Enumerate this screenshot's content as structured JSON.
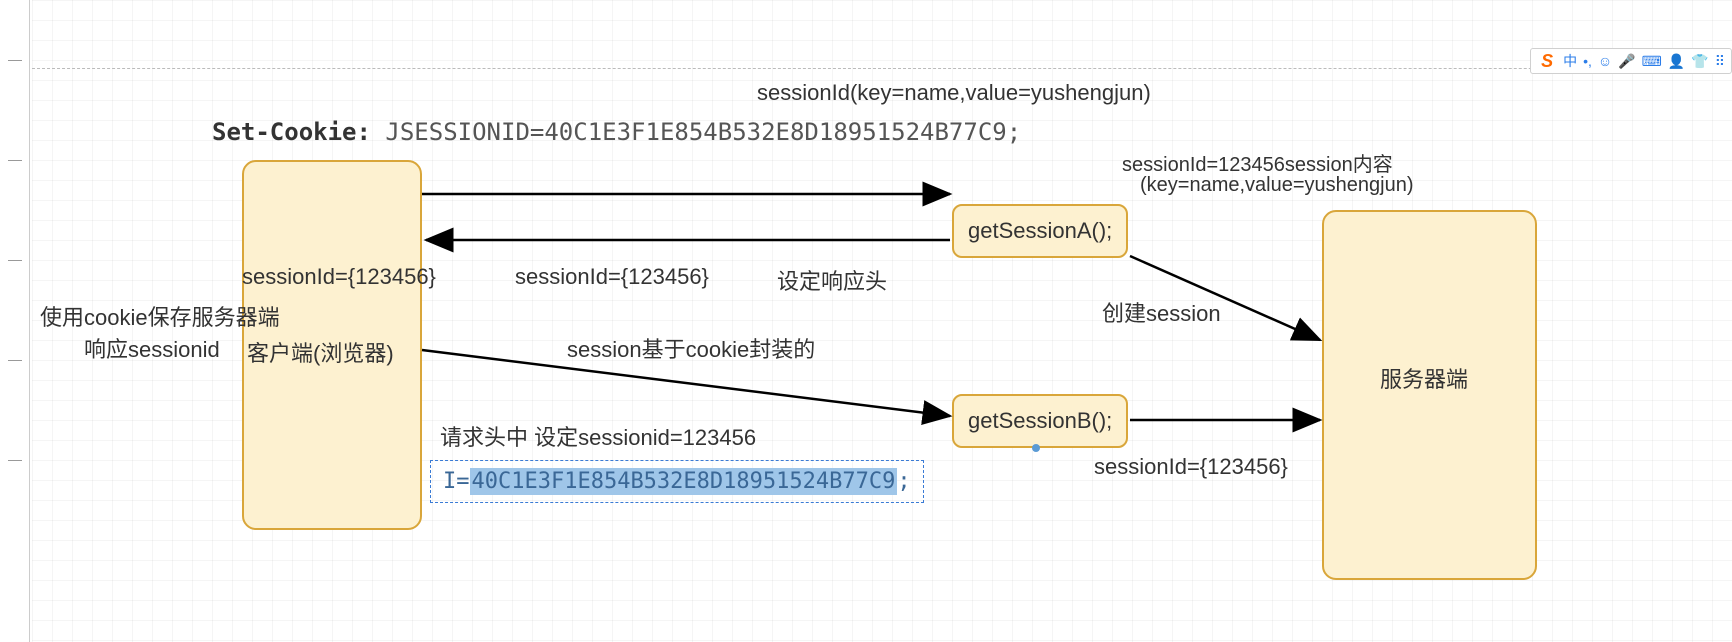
{
  "header": {
    "label_bold": "Set-Cookie:",
    "label_mono": "JSESSIONID=40C1E3F1E854B532E8D18951524B77C9;",
    "top_note": "sessionId(key=name,value=yushengjun)"
  },
  "client": {
    "title": "客户端(浏览器)",
    "side_note_1": "使用cookie保存服务器端",
    "side_note_2": "响应sessionid"
  },
  "server": {
    "title": "服务器端",
    "top_note_1": "sessionId=123456session内容",
    "top_note_2": "(key=name,value=yushengjun)",
    "create_label": "创建session",
    "bottom_note": "sessionId={123456}"
  },
  "nodes": {
    "getA": "getSessionA();",
    "getB": "getSessionB();"
  },
  "arrows": {
    "a_to_client_1": "sessionId={123456}",
    "a_to_client_2": "sessionId={123456}",
    "a_to_client_3": "设定响应头",
    "client_to_b": "session基于cookie封装的",
    "request_header": "请求头中 设定sessionid=123456"
  },
  "selected_text": {
    "prefix": "I=",
    "highlight": "40C1E3F1E854B532E8D18951524B77C9",
    "suffix": ";"
  },
  "ime": {
    "logo": "S",
    "items": [
      "中",
      "•,",
      "☺",
      "🎤",
      "⌨",
      "👤",
      "👕",
      "⠿"
    ]
  }
}
